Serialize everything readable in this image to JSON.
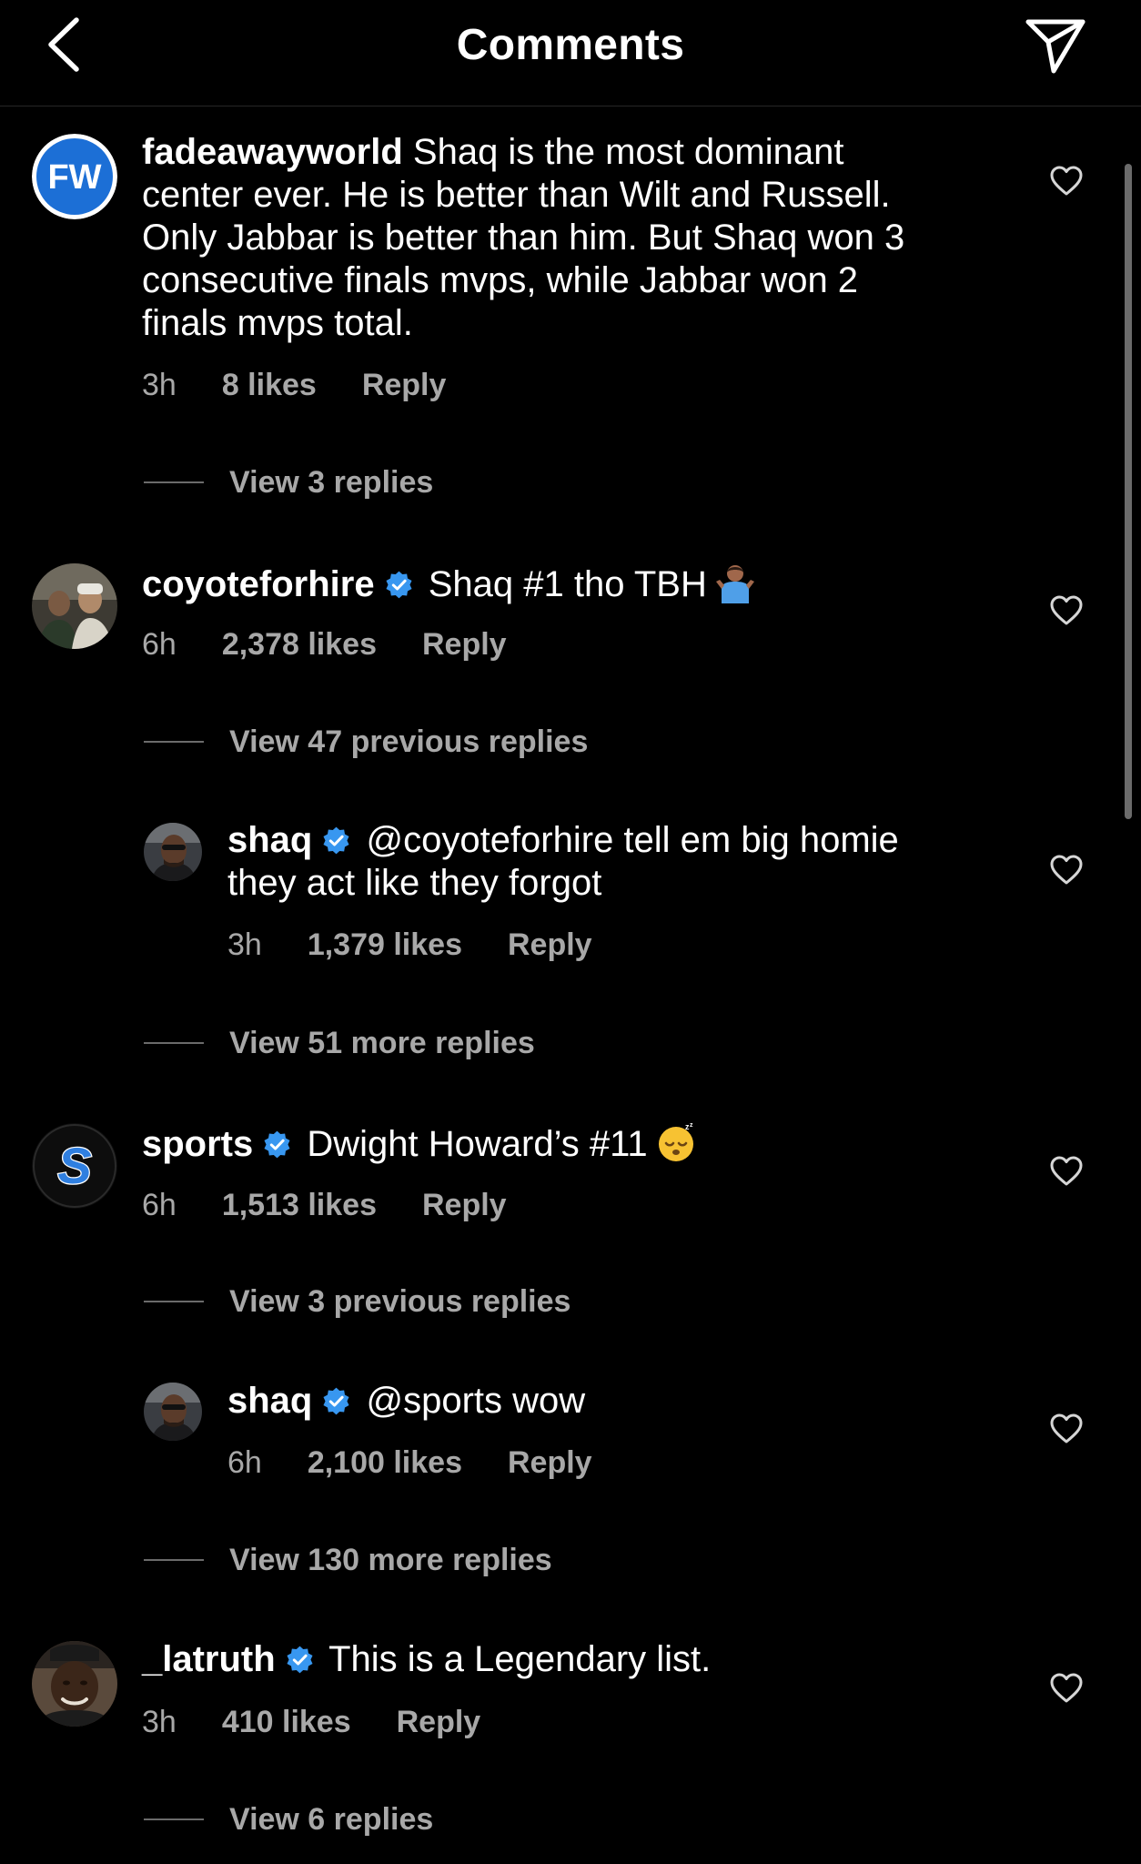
{
  "header": {
    "title": "Comments",
    "back_icon": "chevron-left-icon",
    "send_icon": "send-icon"
  },
  "colors": {
    "background": "#000000",
    "text_primary": "#ffffff",
    "text_secondary": "#a8a8a8",
    "verified": "#3897f0"
  },
  "comments": [
    {
      "username": "fadeawayworld",
      "avatar_text": "FW",
      "verified": false,
      "text_lines": [
        "Shaq is the most dominant",
        "center ever. He is better than Wilt and Russell.",
        "Only Jabbar is better than him. But Shaq won 3",
        "consecutive finals mvps, while Jabbar won 2",
        "finals mvps total."
      ],
      "time": "3h",
      "likes": "8 likes",
      "reply": "Reply",
      "view_replies": "View 3 replies"
    },
    {
      "username": "coyoteforhire",
      "verified": true,
      "text": "Shaq #1 tho TBH",
      "emoji": "shrug-emoji",
      "time": "6h",
      "likes": "2,378 likes",
      "reply": "Reply",
      "view_previous": "View 47 previous replies",
      "reply_item": {
        "username": "shaq",
        "verified": true,
        "text_lines": [
          "@coyoteforhire tell em big homie",
          "they act like they forgot"
        ],
        "time": "3h",
        "likes": "1,379 likes",
        "reply": "Reply"
      },
      "view_more": "View 51 more replies"
    },
    {
      "username": "sports",
      "avatar_text": "S",
      "verified": true,
      "text": "Dwight Howard’s #11",
      "emoji": "sleeping-face-emoji",
      "time": "6h",
      "likes": "1,513 likes",
      "reply": "Reply",
      "view_previous": "View 3 previous replies",
      "reply_item": {
        "username": "shaq",
        "verified": true,
        "text": "@sports wow",
        "time": "6h",
        "likes": "2,100 likes",
        "reply": "Reply"
      },
      "view_more": "View 130 more replies"
    },
    {
      "username": "_latruth",
      "verified": true,
      "text": "This is a Legendary list.",
      "time": "3h",
      "likes": "410 likes",
      "reply": "Reply",
      "view_replies": "View 6 replies"
    }
  ]
}
